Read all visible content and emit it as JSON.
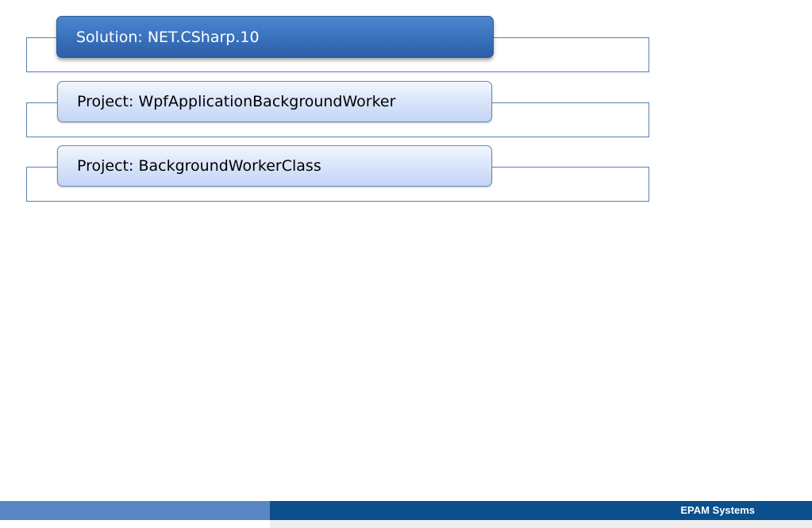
{
  "items": [
    {
      "label": "Solution: NET.CSharp.10",
      "kind": "solution"
    },
    {
      "label": "Project: WpfApplicationBackgroundWorker",
      "kind": "project"
    },
    {
      "label": "Project: BackgroundWorkerClass",
      "kind": "project"
    }
  ],
  "footer": {
    "brand": "EPAM Systems"
  },
  "colors": {
    "solution_fill": "#3b74c0",
    "project_fill": "#dde8fb",
    "frame_border": "#5b7fb0",
    "footer_dark": "#0b4f8c",
    "footer_light": "#5b86c6"
  }
}
